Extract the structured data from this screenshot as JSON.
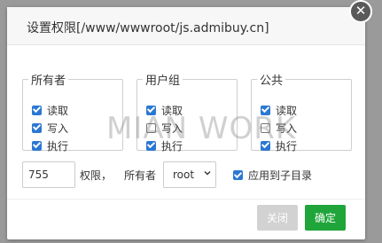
{
  "dialog": {
    "title": "设置权限[/www/wwwroot/js.admibuy.cn]",
    "close_icon": "close-icon"
  },
  "groups": [
    {
      "legend": "所有者",
      "items": [
        {
          "label": "读取",
          "checked": true
        },
        {
          "label": "写入",
          "checked": true
        },
        {
          "label": "执行",
          "checked": true
        }
      ]
    },
    {
      "legend": "用户组",
      "items": [
        {
          "label": "读取",
          "checked": true
        },
        {
          "label": "写入",
          "checked": false
        },
        {
          "label": "执行",
          "checked": true
        }
      ]
    },
    {
      "legend": "公共",
      "items": [
        {
          "label": "读取",
          "checked": true
        },
        {
          "label": "写入",
          "checked": false
        },
        {
          "label": "执行",
          "checked": true
        }
      ]
    }
  ],
  "watermark": "MIAN WORK",
  "permission": {
    "value": "755",
    "label": "权限，",
    "owner_label": "所有者",
    "owner_value": "root",
    "apply_label": "应用到子目录",
    "apply_checked": true
  },
  "buttons": {
    "close": "关闭",
    "confirm": "确定"
  },
  "colors": {
    "accent": "#2b78d3",
    "confirm": "#20a53a",
    "disabled": "#d2d2d2"
  }
}
